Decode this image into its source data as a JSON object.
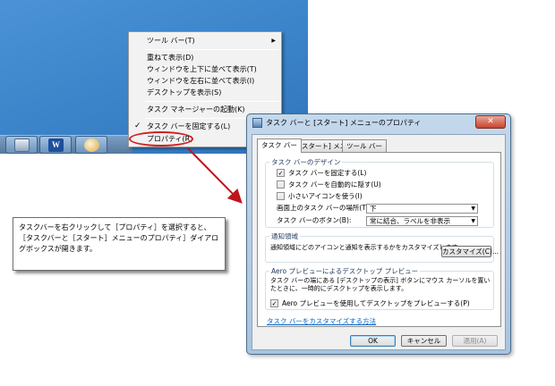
{
  "context_menu": {
    "items": [
      {
        "label": "ツール バー(T)",
        "submenu": true
      },
      {
        "label": "重ねて表示(D)"
      },
      {
        "label": "ウィンドウを上下に並べて表示(T)"
      },
      {
        "label": "ウィンドウを左右に並べて表示(I)"
      },
      {
        "label": "デスクトップを表示(S)"
      },
      {
        "label": "タスク マネージャーの起動(K)"
      },
      {
        "label": "タスク バーを固定する(L)",
        "checked": true
      },
      {
        "label": "プロパティ(R)"
      }
    ],
    "submenu_glyph": "▶",
    "check_glyph": "✓"
  },
  "taskbar": {
    "word_glyph": "W",
    "buttons": [
      {
        "icon": "explorer-icon"
      },
      {
        "icon": "word-icon"
      },
      {
        "icon": "paint-icon"
      }
    ]
  },
  "callout": {
    "text": "タスクバーを右クリックして［プロパティ］を選択すると、［タスクバーと［スタート］メニューのプロパティ］ダイアログボックスが開きます。"
  },
  "dialog": {
    "title": "タスク バーと [スタート] メニューのプロパティ",
    "close_glyph": "✕",
    "tabs": [
      "タスク バー",
      "[スタート] メニュー",
      "ツール バー"
    ],
    "taskbar_design": {
      "title": "タスク バーのデザイン",
      "checkboxes": [
        {
          "label": "タスク バーを固定する(L)",
          "checked": true
        },
        {
          "label": "タスク バーを自動的に隠す(U)",
          "checked": false
        },
        {
          "label": "小さいアイコンを使う(I)",
          "checked": false
        }
      ],
      "location_label": "画面上のタスク バーの場所(T):",
      "location_value": "下",
      "buttons_label": "タスク バーのボタン(B):",
      "buttons_value": "常に結合、ラベルを非表示"
    },
    "notification_area": {
      "title": "通知領域",
      "text": "通知領域にどのアイコンと通知を表示するかをカスタマイズします。",
      "customize_button": "カスタマイズ(C)..."
    },
    "aero_peek": {
      "title": "Aero プレビューによるデスクトップ プレビュー",
      "text": "タスク バーの端にある [デスクトップの表示] ボタンにマウス カーソルを置いたときに、一時的にデスクトップを表示します。",
      "checkbox": {
        "label": "Aero プレビューを使用してデスクトップをプレビューする(P)",
        "checked": true
      }
    },
    "customize_link": "タスク バーをカスタマイズする方法",
    "select_arrow": "▼",
    "check_glyph": "✓",
    "footer": {
      "ok": "OK",
      "cancel": "キャンセル",
      "apply": "適用(A)"
    }
  },
  "colors": {
    "desktop": "#3b83c8",
    "highlight_ring": "#d02020",
    "arrow": "#c0141c",
    "link": "#0066cc"
  }
}
